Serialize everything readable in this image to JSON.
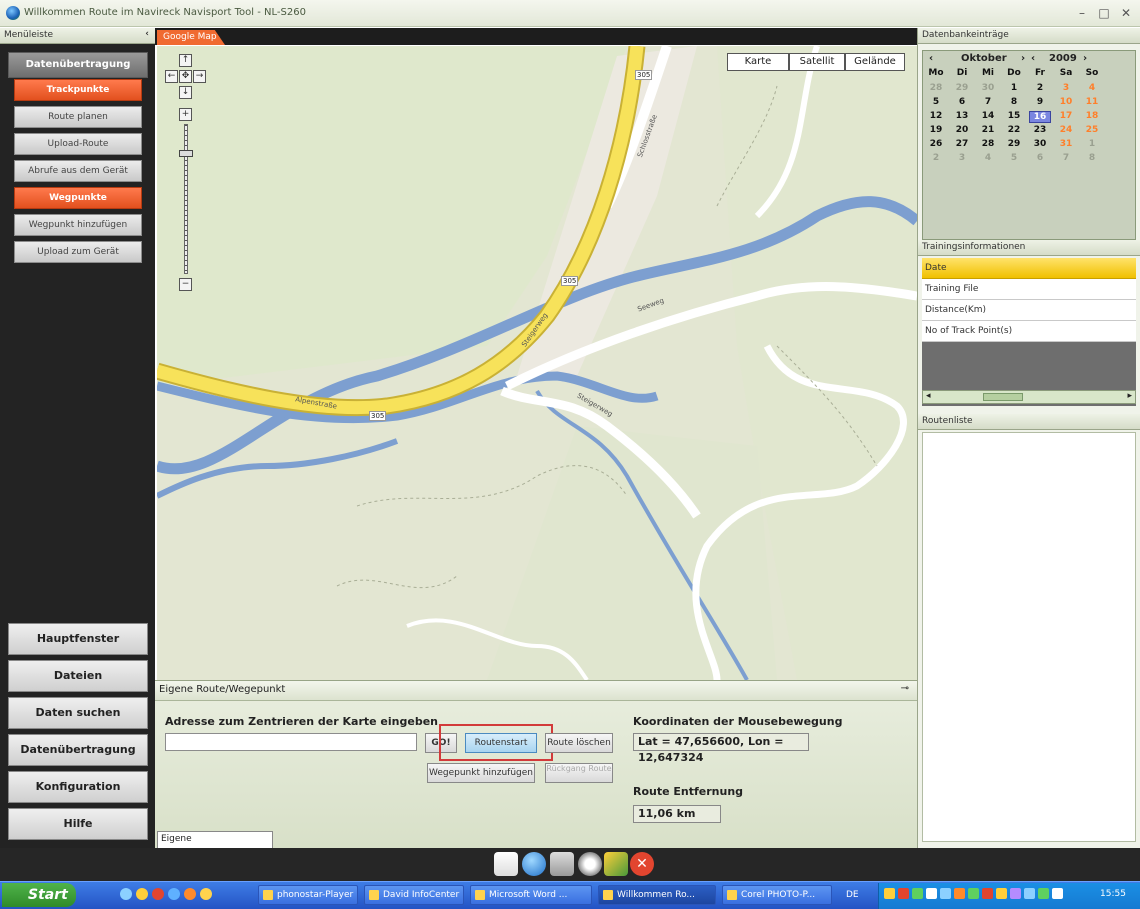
{
  "window": {
    "title": "Willkommen Route im Navireck Navisport Tool - NL-S260"
  },
  "left_panel": {
    "header": "Menüleiste",
    "pin": "‹",
    "section_title": "Datenübertragung",
    "items": [
      {
        "label": "Trackpunkte",
        "active": true
      },
      {
        "label": "Route planen",
        "active": false
      },
      {
        "label": "Upload-Route",
        "active": false
      },
      {
        "label": "Abrufe aus dem Gerät",
        "active": false
      },
      {
        "label": "Wegpunkte",
        "active": true
      },
      {
        "label": "Wegpunkt hinzufügen",
        "active": false
      },
      {
        "label": "Upload zum Gerät",
        "active": false
      }
    ],
    "bottom_sections": [
      "Hauptfenster",
      "Dateien",
      "Daten suchen",
      "Datenübertragung",
      "Konfiguration",
      "Hilfe"
    ]
  },
  "map": {
    "tab": "Google Map",
    "map_types": [
      "Karte",
      "Satellit",
      "Gelände"
    ],
    "road_labels": [
      "305",
      "305",
      "305",
      "Schlosstraße",
      "Steigerweg",
      "Alpenstraße",
      "Steigerweg",
      "Seeweg"
    ]
  },
  "route_panel": {
    "header": "Eigene Route/Wegepunkt",
    "address_label": "Adresse zum Zentrieren der Karte eingeben",
    "address_value": "",
    "go_button": "GO!",
    "route_start_button": "Routenstart",
    "route_delete_button": "Route löschen",
    "add_waypoint_button": "Wegepunkt hinzufügen",
    "reverse_route_button": "Rückgang Route",
    "coords_label": "Koordinaten der Mousebewegung",
    "coords_value": "Lat = 47,656600, Lon = 12,647324",
    "distance_label": "Route Entfernung",
    "distance_value": "11,06 km",
    "bottom_tab": "Eigene Route/Wegepunkt"
  },
  "right_panel": {
    "calendar_header": "Datenbankeinträge",
    "calendar": {
      "month": "Oktober",
      "year": "2009",
      "weekdays": [
        "Mo",
        "Di",
        "Mi",
        "Do",
        "Fr",
        "Sa",
        "So"
      ],
      "weeks": [
        [
          "28",
          "29",
          "30",
          "1",
          "2",
          "3",
          "4"
        ],
        [
          "5",
          "6",
          "7",
          "8",
          "9",
          "10",
          "11"
        ],
        [
          "12",
          "13",
          "14",
          "15",
          "16",
          "17",
          "18"
        ],
        [
          "19",
          "20",
          "21",
          "22",
          "23",
          "24",
          "25"
        ],
        [
          "26",
          "27",
          "28",
          "29",
          "30",
          "31",
          "1"
        ],
        [
          "2",
          "3",
          "4",
          "5",
          "6",
          "7",
          "8"
        ]
      ],
      "today": "16"
    },
    "training_header": "Trainingsinformationen",
    "training_rows": [
      "Date",
      "Training File",
      "Distance(Km)",
      "No of Track Point(s)"
    ],
    "route_list_header": "Routenliste"
  },
  "taskbar": {
    "start": "Start",
    "buttons": [
      "phonostar-Player",
      "David InfoCenter",
      "Microsoft Word ...",
      "Willkommen Ro...",
      "Corel PHOTO-P...",
      "DE"
    ],
    "clock": "15:55"
  },
  "colors": {
    "accent_orange": "#f06a30",
    "road_yellow": "#f7e25a",
    "water_blue": "#7d9fd0",
    "map_bg": "#e3e6d2"
  }
}
